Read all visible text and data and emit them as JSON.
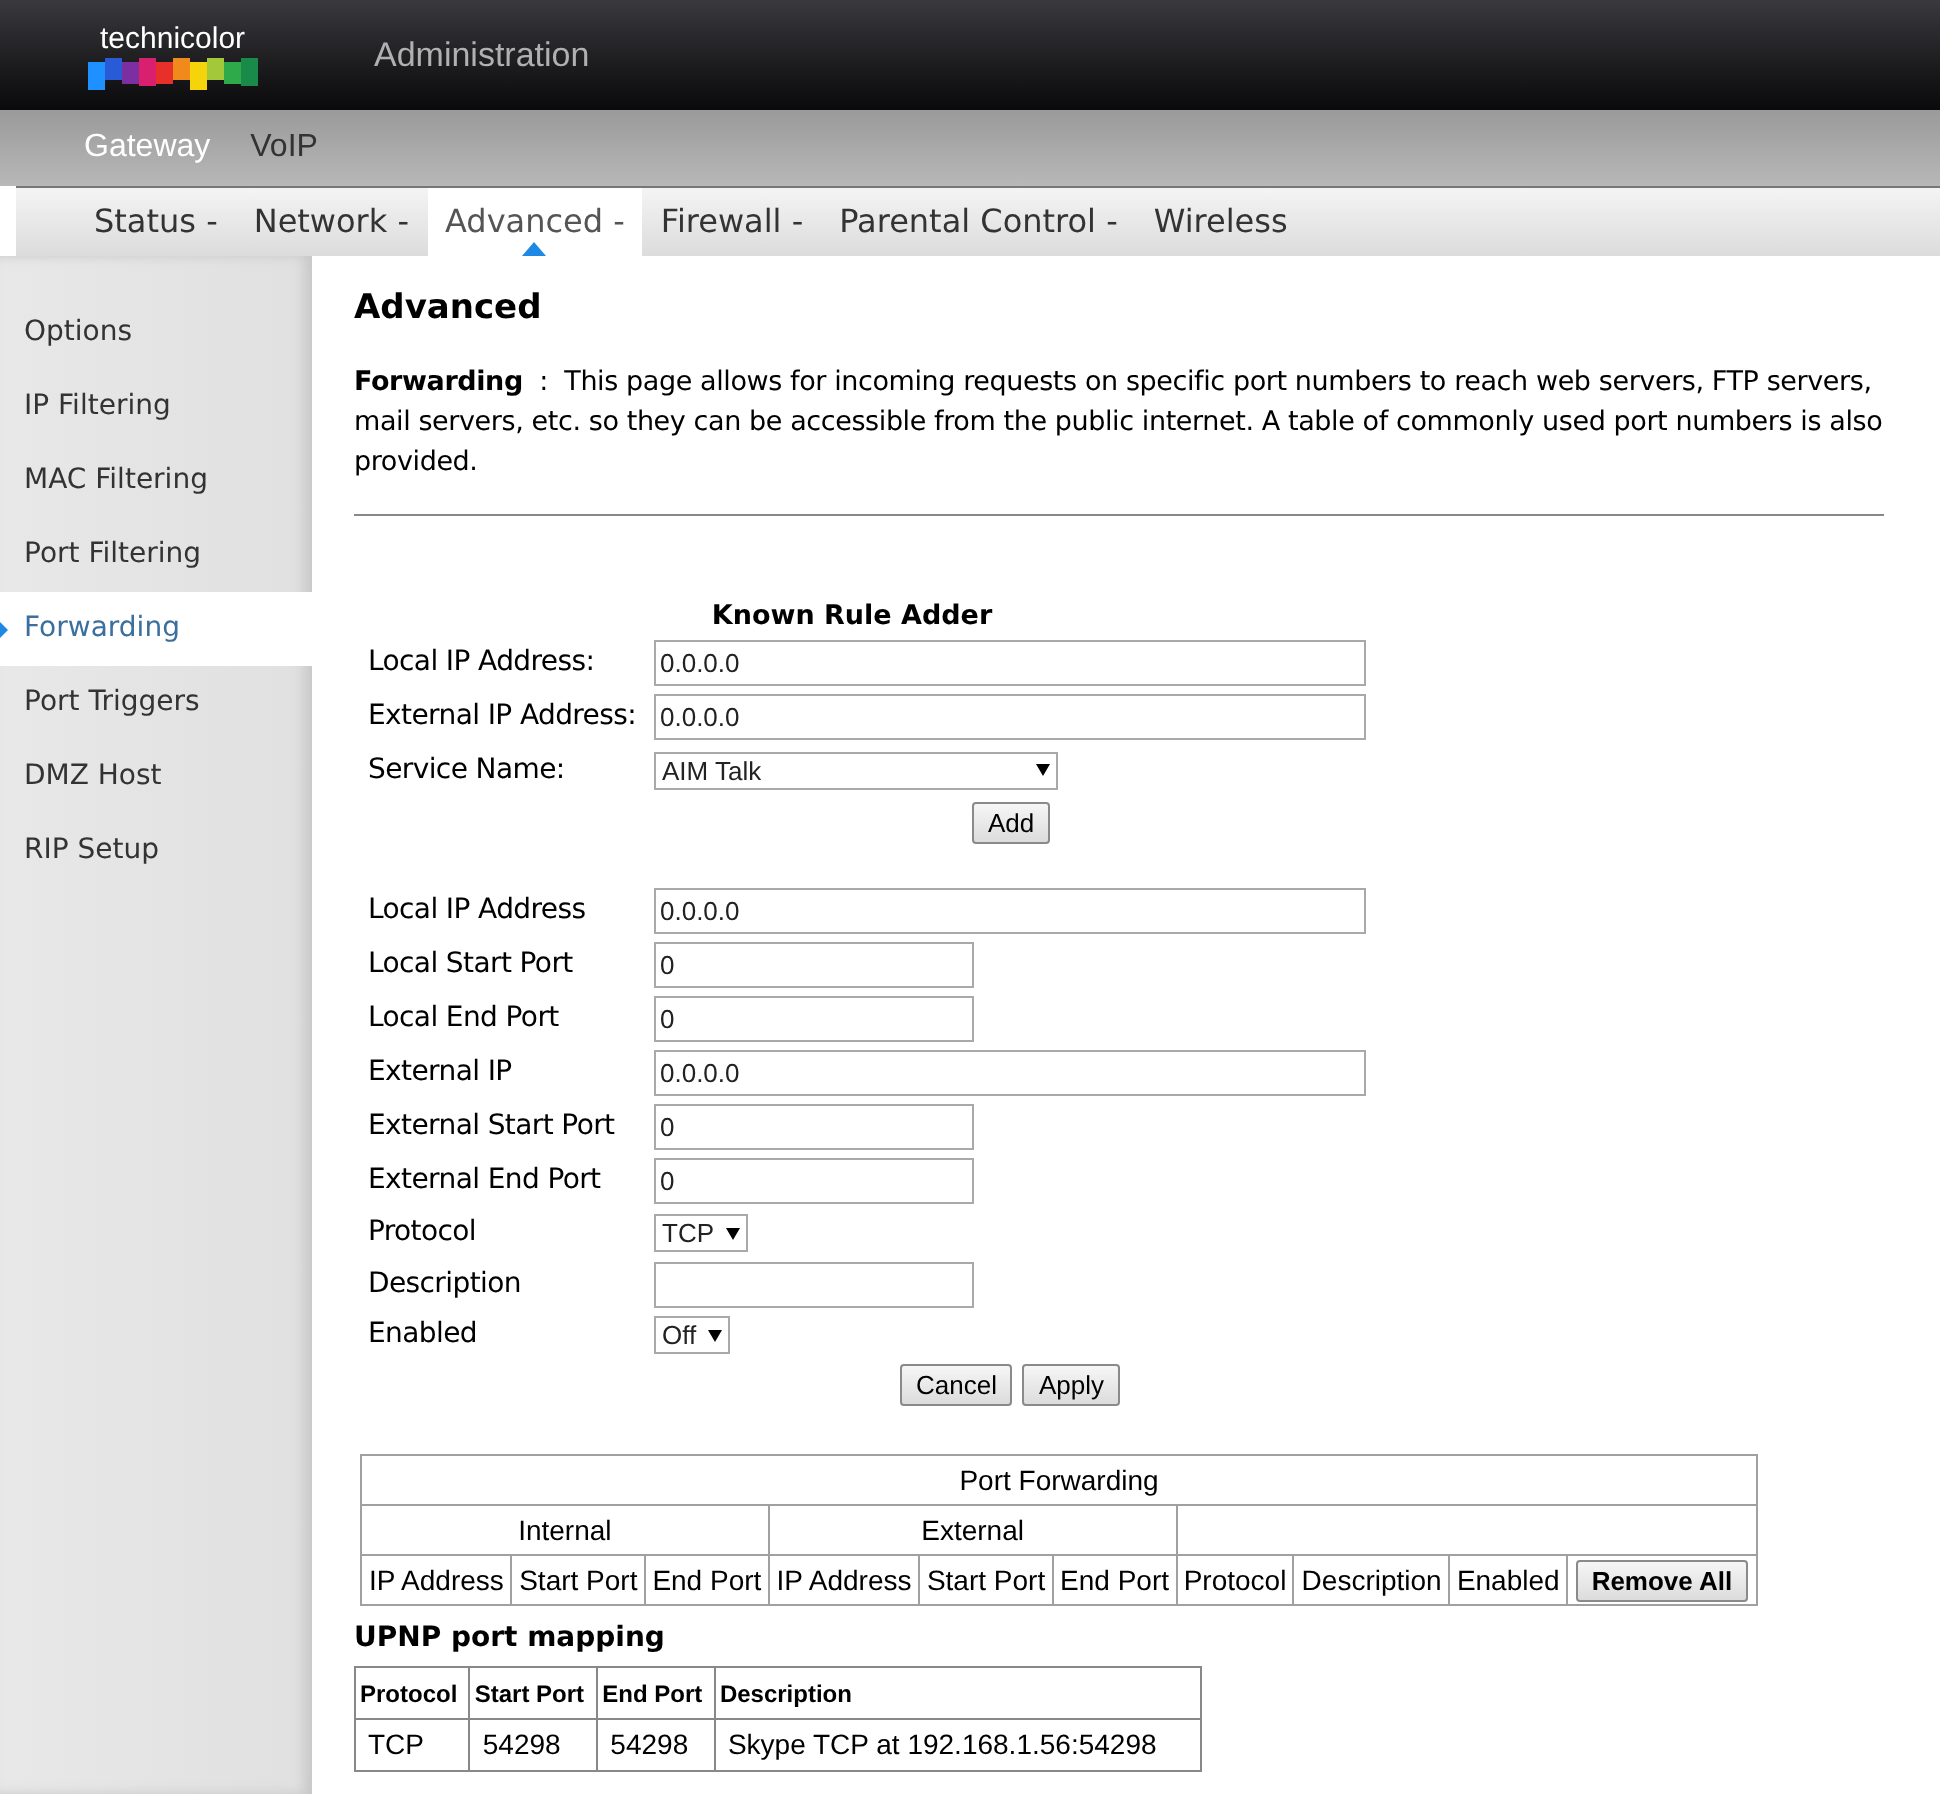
{
  "header": {
    "logo": "technicolor",
    "title": "Administration"
  },
  "top_nav": [
    {
      "label": "Gateway",
      "selected": true
    },
    {
      "label": "VoIP",
      "selected": false
    }
  ],
  "tabs": [
    {
      "label": "Status -",
      "selected": false
    },
    {
      "label": "Network -",
      "selected": false
    },
    {
      "label": "Advanced -",
      "selected": true
    },
    {
      "label": "Firewall -",
      "selected": false
    },
    {
      "label": "Parental Control -",
      "selected": false
    },
    {
      "label": "Wireless",
      "selected": false
    }
  ],
  "sidebar": {
    "items": [
      {
        "label": "Options",
        "selected": false
      },
      {
        "label": "IP Filtering",
        "selected": false
      },
      {
        "label": "MAC Filtering",
        "selected": false
      },
      {
        "label": "Port Filtering",
        "selected": false
      },
      {
        "label": "Forwarding",
        "selected": true
      },
      {
        "label": "Port Triggers",
        "selected": false
      },
      {
        "label": "DMZ Host",
        "selected": false
      },
      {
        "label": "RIP Setup",
        "selected": false
      }
    ]
  },
  "page": {
    "title": "Advanced",
    "intro_label": "Forwarding",
    "intro_separator": ":",
    "intro_text": "This page allows for incoming requests on specific port numbers to reach web servers, FTP servers, mail servers, etc. so they can be accessible from the public internet. A table of commonly used port numbers is also provided."
  },
  "known_rule_adder": {
    "title": "Known Rule Adder",
    "fields": [
      {
        "label": "Local IP Address:",
        "kind": "address",
        "value": "0.0.0.0"
      },
      {
        "label": "External IP Address:",
        "kind": "address",
        "value": "0.0.0.0"
      },
      {
        "label": "Service Name:",
        "kind": "service",
        "value": "AIM Talk"
      }
    ],
    "button": "Add"
  },
  "rule_form": {
    "fields": [
      {
        "label": "Local IP Address",
        "kind": "address",
        "value": "0.0.0.0"
      },
      {
        "label": "Local Start Port",
        "kind": "port",
        "value": "0"
      },
      {
        "label": "Local End Port",
        "kind": "port",
        "value": "0"
      },
      {
        "label": "External IP",
        "kind": "address",
        "value": "0.0.0.0"
      },
      {
        "label": "External Start Port",
        "kind": "port",
        "value": "0"
      },
      {
        "label": "External End Port",
        "kind": "port",
        "value": "0"
      },
      {
        "label": "Protocol",
        "kind": "select",
        "value": "TCP"
      },
      {
        "label": "Description",
        "kind": "port"
      },
      {
        "label": "Enabled",
        "kind": "select",
        "value": "Off"
      }
    ],
    "buttons": [
      "Cancel",
      "Apply"
    ]
  },
  "port_forwarding": {
    "title": "Port Forwarding",
    "groups": [
      "Internal",
      "External"
    ],
    "columns": [
      "IP Address",
      "Start Port",
      "End Port",
      "IP Address",
      "Start Port",
      "End Port",
      "Protocol",
      "Description",
      "Enabled"
    ],
    "button": "Remove All"
  },
  "upnp": {
    "title": "UPNP port mapping",
    "columns": [
      "Protocol",
      "Start Port",
      "End Port",
      "Description"
    ],
    "rows": [
      [
        "TCP",
        "54298",
        "54298",
        "Skype TCP at 192.168.1.56:54298"
      ]
    ]
  }
}
